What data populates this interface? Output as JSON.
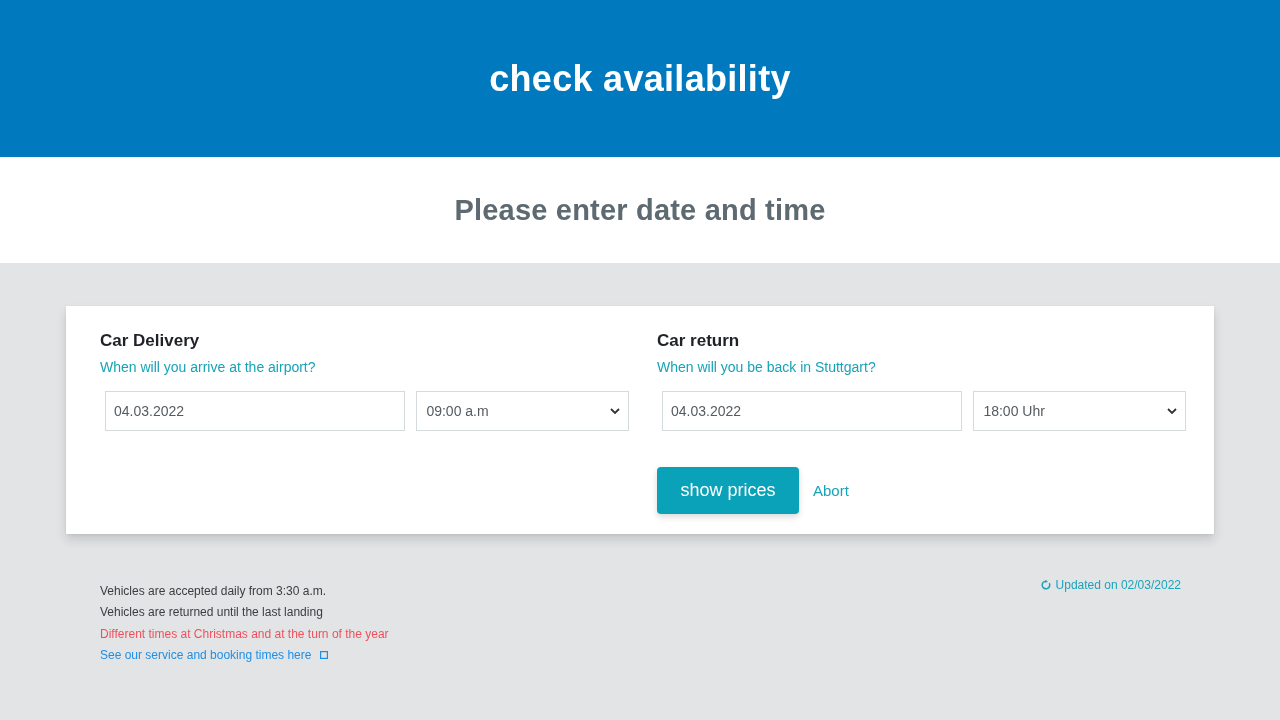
{
  "header": {
    "title": "check availability"
  },
  "intro": {
    "heading": "Please enter date and time"
  },
  "booking_form": {
    "sections": [
      {
        "heading": "Car Delivery",
        "question": "When will you arrive at the airport?",
        "date": "04.03.2022",
        "time": "09:00 a.m"
      },
      {
        "heading": "Car return",
        "question": "When will you be back in Stuttgart?",
        "date": "04.03.2022",
        "time": "18:00 Uhr"
      }
    ],
    "buttons": [
      {
        "kind": "primary",
        "label": "show prices"
      },
      {
        "kind": "link",
        "label": "Abort"
      }
    ]
  },
  "notes": [
    {
      "kind": "text",
      "text": "Vehicles are accepted daily from 3:30 a.m."
    },
    {
      "kind": "text",
      "text": "Vehicles are returned until the last landing"
    },
    {
      "kind": "warning",
      "text": "Different times at Christmas and at the turn of the year"
    },
    {
      "kind": "link",
      "text": "See our service and booking times here"
    }
  ],
  "updated": {
    "text": "Updated on 02/03/2022"
  }
}
